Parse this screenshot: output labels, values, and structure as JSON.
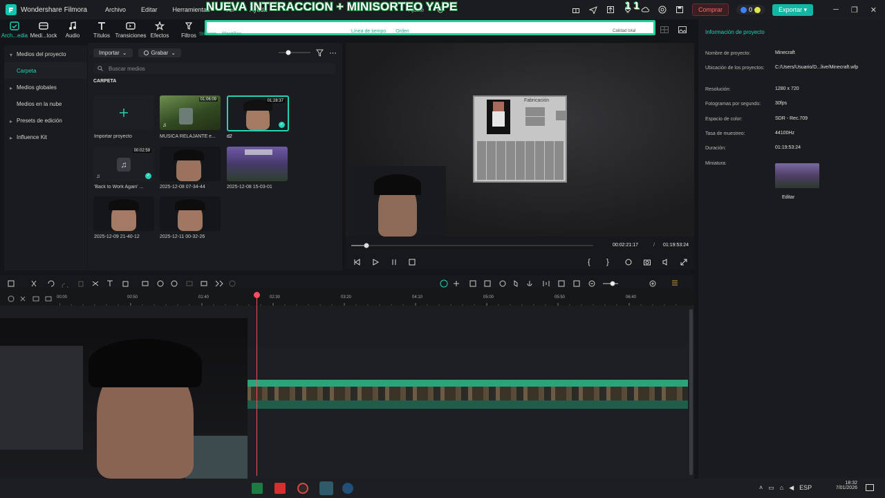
{
  "app": {
    "name": "Wondershare Filmora",
    "menu": [
      "Archivo",
      "Editar",
      "Herramientas",
      "Ver",
      "Ayuda"
    ],
    "buy_label": "Comprar",
    "credits": "0",
    "export_label": "Exportar"
  },
  "overlay": {
    "banner_text": "NUEVA INTERACCION + MINISORTEO YAPE",
    "counter": "1  1",
    "partial_text_right": "Ajuste",
    "under_banner": [
      "Línea de tiempo",
      "Orden"
    ],
    "under_banner_right": "Calidad total"
  },
  "tabs": [
    {
      "label": "Arch...edia",
      "icon": "import-icon"
    },
    {
      "label": "Medi...tock",
      "icon": "stock-media-icon"
    },
    {
      "label": "Audio",
      "icon": "audio-icon"
    },
    {
      "label": "Títulos",
      "icon": "titles-icon"
    },
    {
      "label": "Transiciones",
      "icon": "transitions-icon"
    },
    {
      "label": "Efectos",
      "icon": "effects-icon"
    },
    {
      "label": "Filtros",
      "icon": "filters-icon"
    },
    {
      "label": "Stickers",
      "icon": "stickers-icon"
    },
    {
      "label": "Plantillas",
      "icon": "templates-icon"
    }
  ],
  "leftnav": {
    "items": [
      {
        "label": "Medios del proyecto",
        "type": "group"
      },
      {
        "label": "Carpeta",
        "type": "sub"
      },
      {
        "label": "Medios globales",
        "type": "group"
      },
      {
        "label": "Medios en la nube",
        "type": "plain"
      },
      {
        "label": "Presets de edición",
        "type": "group"
      },
      {
        "label": "Influence Kit",
        "type": "group"
      }
    ]
  },
  "media": {
    "import_label": "Importar",
    "record_label": "Grabar",
    "search_placeholder": "Buscar medios",
    "section": "CARPETA",
    "items": [
      {
        "label": "Importar proyecto",
        "duration": ""
      },
      {
        "label": "MUSICA RELAJANTE e...",
        "duration": "01:06:09"
      },
      {
        "label": "d2",
        "duration": "01:28:37"
      },
      {
        "label": "'Back to Work Again' ...",
        "duration": "00:02:59"
      },
      {
        "label": "2025-12-08 07-34-44",
        "duration": ""
      },
      {
        "label": "2025-12-08 15-03-01",
        "duration": ""
      },
      {
        "label": "2025-12-09 21-40-12",
        "duration": ""
      },
      {
        "label": "2025-12-11 00-32-26",
        "duration": ""
      }
    ]
  },
  "preview": {
    "crafting_title": "Fabricación",
    "current_time": "00:02:21:17",
    "separator": "/",
    "total_time": "01:19:53:24"
  },
  "project_info": {
    "title": "Información de proyecto",
    "rows": [
      {
        "label": "Nombre de proyecto:",
        "value": "Minecraft"
      },
      {
        "label": "Ubicación de los proyectos:",
        "value": "C:/Users/Usuario/D...live/Minecraft.wfp"
      },
      {
        "label": "Resolución:",
        "value": "1280 x 720"
      },
      {
        "label": "Fotogramas por segundo:",
        "value": "30fps"
      },
      {
        "label": "Espacio de color:",
        "value": "SDR - Rec.709"
      },
      {
        "label": "Tasa de muestreo:",
        "value": "44100Hz"
      },
      {
        "label": "Duración:",
        "value": "01:19:53:24"
      },
      {
        "label": "Miniatura:",
        "value": ""
      }
    ],
    "edit_label": "Editar"
  },
  "timeline": {
    "ruler_labels": [
      "00:00",
      "00:50",
      "01:40",
      "02:30",
      "03:20",
      "04:10",
      "05:00",
      "05:50",
      "06:40"
    ]
  },
  "taskbar": {
    "lang": "ESP",
    "time": "18:32",
    "date": "7/01/2026"
  },
  "colors": {
    "accent": "#22d3b8",
    "track": "#2da37c",
    "playhead": "#ff4d5e"
  }
}
